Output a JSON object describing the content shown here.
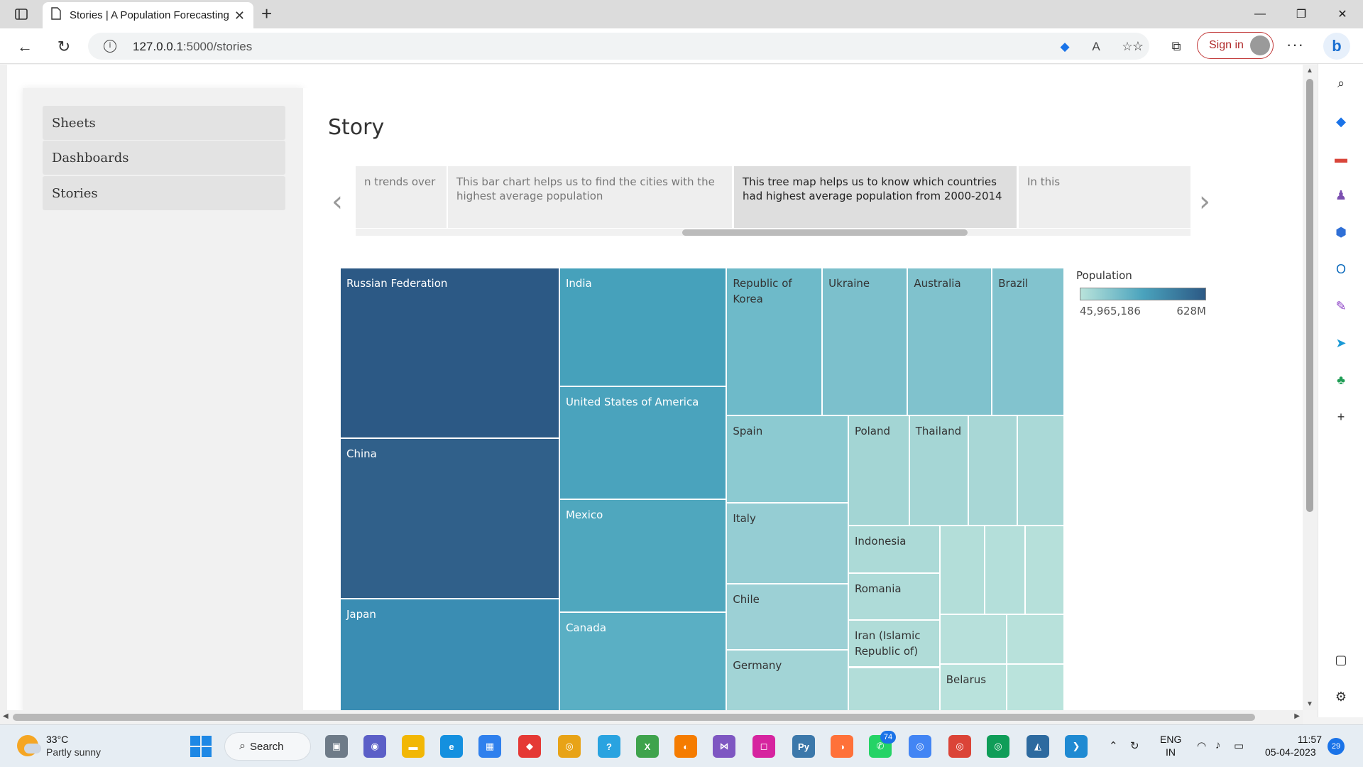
{
  "browser": {
    "tab_title": "Stories | A Population Forecasting",
    "url_host": "127.0.0.1",
    "url_path": ":5000/stories",
    "signin_label": "Sign in",
    "colors": {
      "signin": "#c23b3b",
      "bing": "#1a6fd1"
    }
  },
  "sidebar": {
    "items": [
      {
        "label": "Sheets"
      },
      {
        "label": "Dashboards"
      },
      {
        "label": "Stories"
      }
    ]
  },
  "story": {
    "title": "Story",
    "points": [
      {
        "text": "n trends over"
      },
      {
        "text": "This bar chart helps us to find the cities with the highest average population"
      },
      {
        "text": "This tree map helps us to know which countries had highest average population from 2000-2014"
      },
      {
        "text": "In this"
      }
    ],
    "active_point": 2
  },
  "treemap": {
    "legend_title": "Population",
    "legend_min": "45,965,186",
    "legend_max": "628M",
    "color_low": "#b9e3db",
    "color_high": "#2c5985",
    "cells": [
      {
        "name": "Russian Federation",
        "color": "#2c5985",
        "dark": true
      },
      {
        "name": "China",
        "color": "#30608a",
        "dark": true
      },
      {
        "name": "Japan",
        "color": "#3a8db3",
        "dark": true
      },
      {
        "name": "India",
        "color": "#46a1bb",
        "dark": true
      },
      {
        "name": "United States of America",
        "color": "#4aa3bd",
        "dark": true
      },
      {
        "name": "Mexico",
        "color": "#4fa7be",
        "dark": true
      },
      {
        "name": "Canada",
        "color": "#5aafc4",
        "dark": true
      },
      {
        "name": "Republic of Korea",
        "color": "#6ebac9",
        "dark": false
      },
      {
        "name": "Ukraine",
        "color": "#7cc0cc",
        "dark": false
      },
      {
        "name": "Australia",
        "color": "#80c2cd",
        "dark": false
      },
      {
        "name": "Brazil",
        "color": "#82c3ce",
        "dark": false
      },
      {
        "name": "Spain",
        "color": "#8ccad1",
        "dark": false
      },
      {
        "name": "Italy",
        "color": "#95cdd3",
        "dark": false
      },
      {
        "name": "Chile",
        "color": "#9cd0d5",
        "dark": false
      },
      {
        "name": "Germany",
        "color": "#a2d4d6",
        "dark": false
      },
      {
        "name": "Poland",
        "color": "#a3d5d4",
        "dark": false
      },
      {
        "name": "Thailand",
        "color": "#a5d6d5",
        "dark": false
      },
      {
        "name": "",
        "color": "#a8d7d6",
        "dark": false
      },
      {
        "name": "",
        "color": "#aad9d7",
        "dark": false
      },
      {
        "name": "Indonesia",
        "color": "#acdad7",
        "dark": false
      },
      {
        "name": "Romania",
        "color": "#aedbd8",
        "dark": false
      },
      {
        "name": "Iran (Islamic Republic of)",
        "color": "#b0dcd8",
        "dark": false
      },
      {
        "name": "",
        "color": "#b2ddd9",
        "dark": false
      },
      {
        "name": "",
        "color": "#b3ded9",
        "dark": false
      },
      {
        "name": "",
        "color": "#b4dfda",
        "dark": false
      },
      {
        "name": "",
        "color": "#b6e0da",
        "dark": false
      },
      {
        "name": "",
        "color": "#b7e0db",
        "dark": false
      },
      {
        "name": "",
        "color": "#b8e1db",
        "dark": false
      },
      {
        "name": "Belarus",
        "color": "#b9e2dc",
        "dark": false
      },
      {
        "name": "",
        "color": "#bae3dc",
        "dark": false
      }
    ]
  },
  "taskbar": {
    "temperature": "33°C",
    "condition": "Partly sunny",
    "search_label": "Search",
    "whatsapp_badge": "74",
    "lang_line1": "ENG",
    "lang_line2": "IN",
    "time": "11:57",
    "date": "05-04-2023",
    "notification_count": "29"
  }
}
